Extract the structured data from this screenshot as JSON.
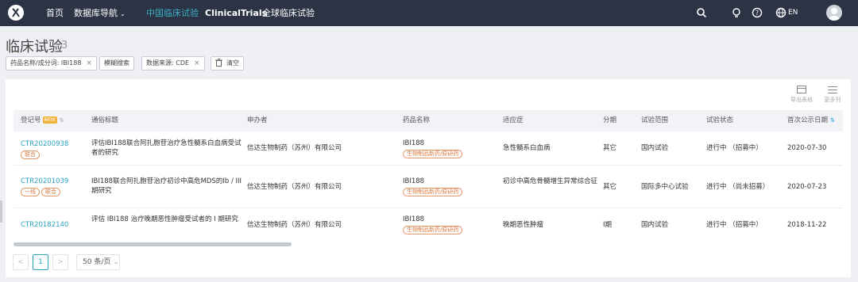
{
  "nav": {
    "home": "首页",
    "db_nav": "数据库导航",
    "tab_china": "中国临床试验",
    "tab_clinicaltrials": "ClinicalTrials",
    "tab_global": "全球临床试验",
    "lang": "EN"
  },
  "page": {
    "title": "临床试验",
    "count": "3"
  },
  "filters": {
    "drug": "药品名称/成分词: IBI188",
    "fuzzy": "模糊搜索",
    "source": "数据来源: CDE",
    "clear": "清空"
  },
  "toolbar": {
    "export": "导出表格",
    "more_cols": "更多列"
  },
  "table": {
    "headers": [
      "登记号",
      "通俗标题",
      "申办者",
      "药品名称",
      "适应症",
      "分期",
      "试验范围",
      "试验状态",
      "首次公示日期"
    ],
    "new_badge": "NEW",
    "rows": [
      {
        "id": "CTR20200938",
        "tags": [
          "联合"
        ],
        "title": "评估IBI188联合阿扎胞苷治疗急性髓系白血病受试者的研究",
        "sponsor": "信达生物制药（苏州）有限公司",
        "drug": "IBI188",
        "drug_tag": "生物制品新药/原研药",
        "indication": "急性髓系白血病",
        "phase": "其它",
        "scope": "国内试验",
        "status": "进行中 （招募中）",
        "date": "2020-07-30"
      },
      {
        "id": "CTR20201039",
        "tags": [
          "一线",
          "联合"
        ],
        "title": "IBI188联合阿扎胞苷治疗初诊中高危MDS的Ib / III期研究",
        "sponsor": "信达生物制药（苏州）有限公司",
        "drug": "IBI188",
        "drug_tag": "生物制品新药/原研药",
        "indication": "初诊中高危骨髓增生异常综合征",
        "phase": "其它",
        "scope": "国际多中心试验",
        "status": "进行中 （尚未招募）",
        "date": "2020-07-23"
      },
      {
        "id": "CTR20182140",
        "tags": [],
        "title": "评估 IBI188 治疗晚期恶性肿瘤受试者的 I 期研究",
        "sponsor": "信达生物制药（苏州）有限公司",
        "drug": "IBI188",
        "drug_tag": "生物制品新药/原研药",
        "indication": "晚期恶性肿瘤",
        "phase": "I期",
        "scope": "国内试验",
        "status": "进行中 （招募中）",
        "date": "2018-11-22"
      }
    ]
  },
  "pagination": {
    "prev": "<",
    "current": "1",
    "next": ">",
    "page_size": "50 条/页"
  },
  "icons": [
    "logo",
    "search-icon",
    "bulb-icon",
    "help-icon",
    "globe-icon",
    "user-avatar",
    "trash-icon",
    "export-icon",
    "list-icon"
  ],
  "colors": {
    "nav_bg": "#2c3344",
    "accent": "#2aa3c4",
    "tag_orange": "#d7793f",
    "badge_new": "#f1b237"
  }
}
